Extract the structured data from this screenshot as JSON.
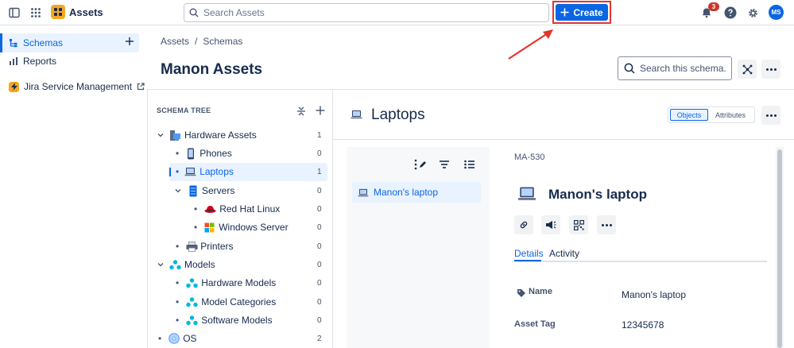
{
  "topbar": {
    "app_name": "Assets",
    "search_placeholder": "Search Assets",
    "create_label": "Create",
    "notifications_count": "3",
    "avatar_initials": "MS",
    "brand_color": "#0c66e4",
    "highlight_color": "#e3342f"
  },
  "sidebar": {
    "items": [
      {
        "label": "Schemas",
        "icon": "hierarchy-icon",
        "selected": true
      },
      {
        "label": "Reports",
        "icon": "bar-chart-icon"
      },
      {
        "label": "Jira Service Management",
        "icon": "lightning-icon"
      }
    ]
  },
  "breadcrumb": {
    "items": [
      "Assets",
      "Schemas"
    ],
    "separator": "/"
  },
  "page": {
    "title": "Manon Assets",
    "schema_search_placeholder": "Search this schema..."
  },
  "tree": {
    "title": "SCHEMA TREE",
    "rows": [
      {
        "label": "Hardware Assets",
        "count": "1",
        "icon": "hardware-assets-icon",
        "expanded": true
      },
      {
        "label": "Phones",
        "count": "0",
        "icon": "phone-icon"
      },
      {
        "label": "Laptops",
        "count": "1",
        "icon": "laptop-icon",
        "selected": true
      },
      {
        "label": "Servers",
        "count": "0",
        "icon": "server-icon",
        "expanded": true
      },
      {
        "label": "Red Hat Linux",
        "count": "0",
        "icon": "red-hat-icon"
      },
      {
        "label": "Windows Server",
        "count": "0",
        "icon": "windows-icon"
      },
      {
        "label": "Printers",
        "count": "0",
        "icon": "printer-icon"
      },
      {
        "label": "Models",
        "count": "0",
        "icon": "models-icon",
        "expanded": true
      },
      {
        "label": "Hardware Models",
        "count": "0",
        "icon": "models-icon"
      },
      {
        "label": "Model Categories",
        "count": "0",
        "icon": "models-icon"
      },
      {
        "label": "Software Models",
        "count": "0",
        "icon": "models-icon"
      },
      {
        "label": "OS",
        "count": "2",
        "icon": "disc-icon"
      }
    ]
  },
  "object_type": {
    "title": "Laptops",
    "toggle": {
      "objects": "Objects",
      "attributes": "Attributes",
      "selected": "Objects"
    }
  },
  "object_list": {
    "items": [
      "Manon's laptop"
    ]
  },
  "object_detail": {
    "key": "MA-530",
    "name": "Manon's laptop",
    "tabs": [
      "Details",
      "Activity"
    ],
    "active_tab": "Details",
    "attributes": [
      {
        "label": "Name",
        "value": "Manon's laptop"
      },
      {
        "label": "Asset Tag",
        "value": "12345678"
      }
    ]
  }
}
